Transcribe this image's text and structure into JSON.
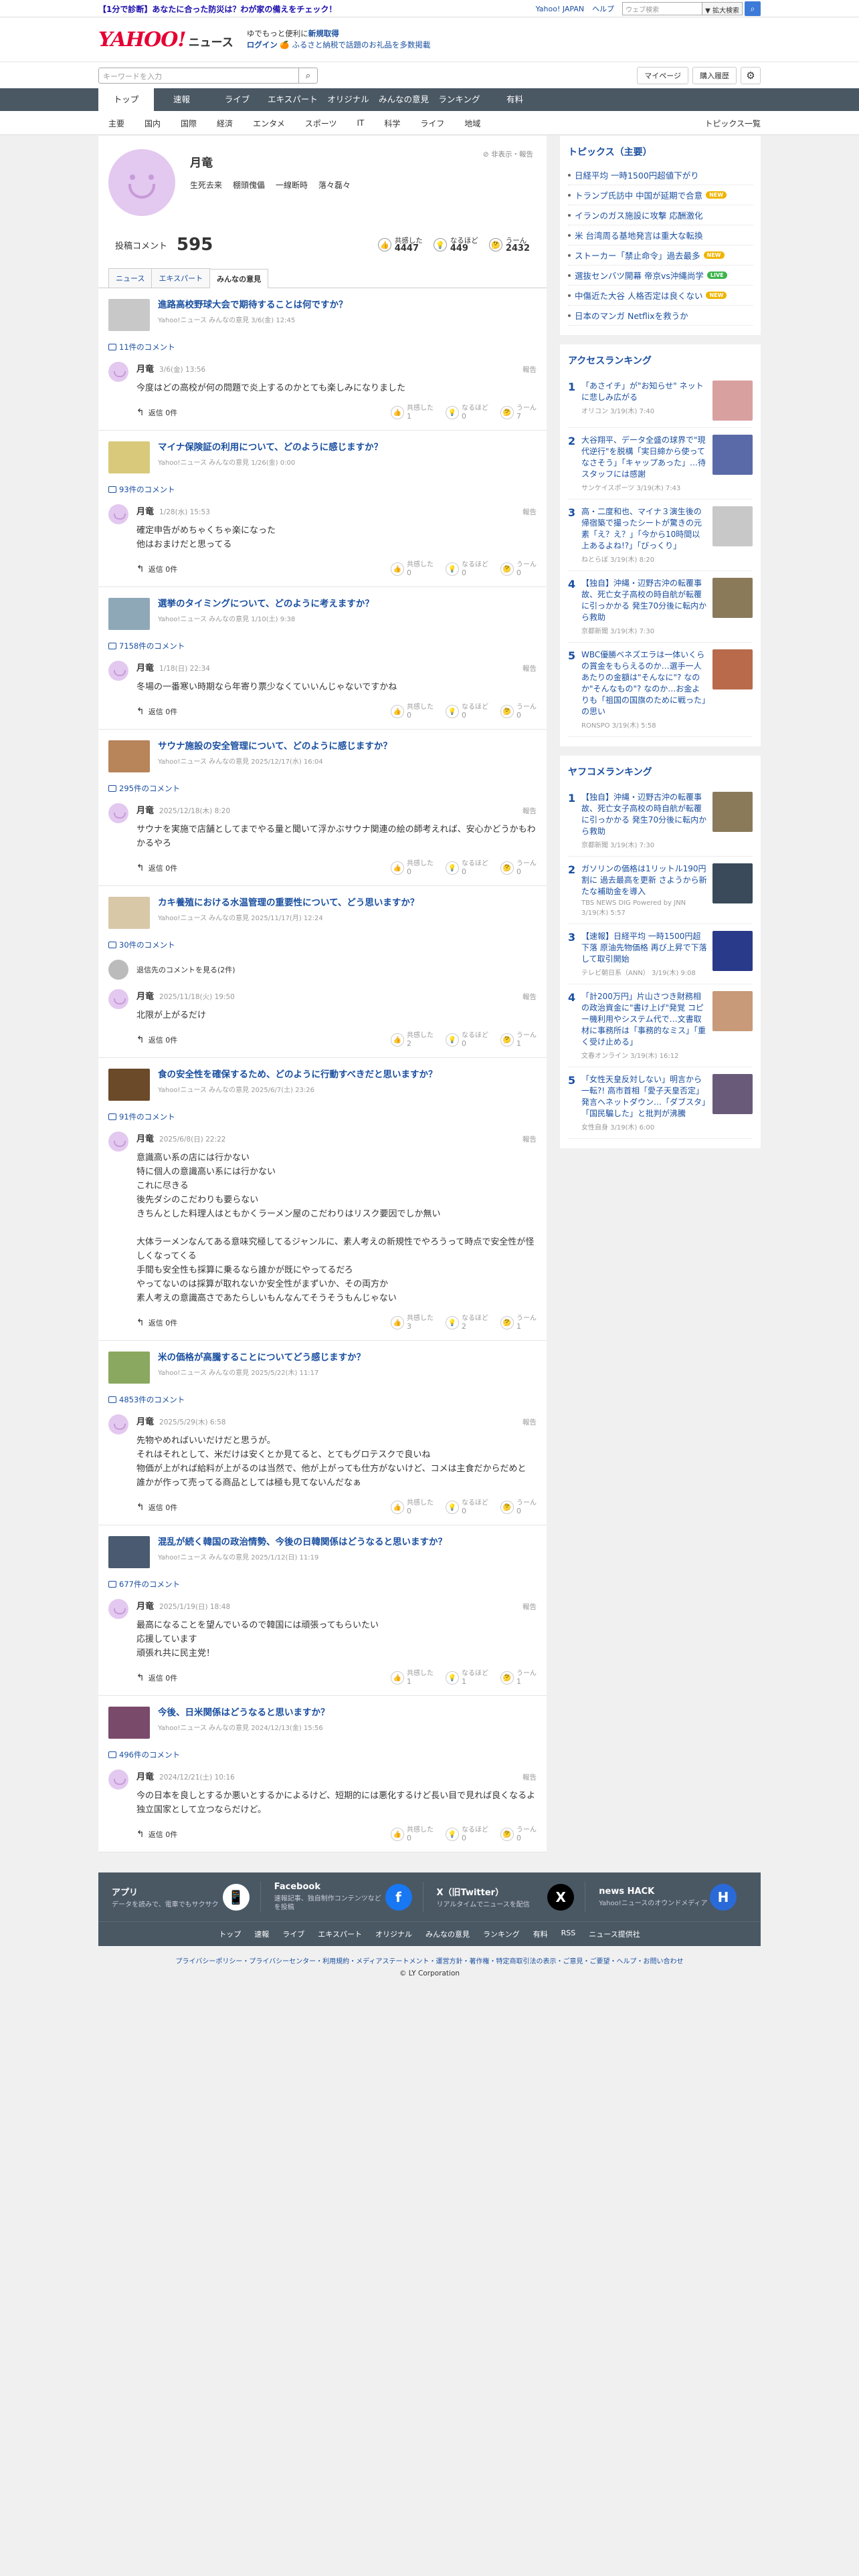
{
  "promo": {
    "text": "【1分で診断】あなたに合った防災は？わが家の備えをチェック！"
  },
  "top_links": {
    "yahoo_japan": "Yahoo! JAPAN",
    "help": "ヘルプ",
    "search_placeholder": "ウェブ検索",
    "search_option": "▼ 拡大検索"
  },
  "logo": {
    "text": "YAHOO!",
    "suffix": "ニュース"
  },
  "header_ad": {
    "line1": "ゆでもっと便利に",
    "line1_bold": "新規取得",
    "login": "ログイン",
    "line2": "🍊 ふるさと納税で話題のお礼品を多数掲載"
  },
  "search": {
    "placeholder": "キーワードを入力",
    "mypage": "マイページ",
    "history": "購入履歴"
  },
  "nav": [
    "トップ",
    "速報",
    "ライブ",
    "エキスパート",
    "オリジナル",
    "みんなの意見",
    "ランキング",
    "有料"
  ],
  "subnav": [
    "主要",
    "国内",
    "国際",
    "経済",
    "エンタメ",
    "スポーツ",
    "IT",
    "科学",
    "ライフ",
    "地域"
  ],
  "subnav_more": "トピックス一覧",
  "profile": {
    "name": "月竜",
    "tags": [
      "生死去来",
      "棚頭傀儡",
      "一線断時",
      "落々磊々"
    ],
    "private_note": "非表示・報告",
    "comments_label": "投稿コメント",
    "comments_count": "595",
    "reacts": [
      {
        "label": "共感した",
        "value": "4447",
        "icon": "👍"
      },
      {
        "label": "なるほど",
        "value": "449",
        "icon": "💡"
      },
      {
        "label": "うーん",
        "value": "2432",
        "icon": "🤔"
      }
    ],
    "tabs": [
      "ニュース",
      "エキスパート",
      "みんなの意見"
    ]
  },
  "cards": [
    {
      "title": "進路高校野球大会で期待することは何ですか？",
      "meta": "Yahoo!ニュース みんなの意見 3/6(金) 12:45",
      "ccount": "11件のコメント",
      "thumb": "#c8c8c8",
      "comments": [
        {
          "name": "月竜",
          "date": "3/6(金) 13:56",
          "text": "今度はどの高校が何の問題で炎上するのかとても楽しみになりました",
          "r": [
            "1",
            "0",
            "7"
          ]
        }
      ]
    },
    {
      "title": "マイナ保険証の利用について、どのように感じますか？",
      "meta": "Yahoo!ニュース みんなの意見 1/26(金) 0:00",
      "ccount": "93件のコメント",
      "thumb": "#d9c97a",
      "comments": [
        {
          "name": "月竜",
          "date": "1/28(水) 15:53",
          "text": "確定申告がめちゃくちゃ楽になった\n他はおまけだと思ってる",
          "r": [
            "0",
            "0",
            "0"
          ]
        }
      ]
    },
    {
      "title": "選挙のタイミングについて、どのように考えますか？",
      "meta": "Yahoo!ニュース みんなの意見 1/10(土) 9:38",
      "ccount": "7158件のコメント",
      "thumb": "#8fa8b8",
      "comments": [
        {
          "name": "月竜",
          "date": "1/18(日) 22:34",
          "text": "冬場の一番寒い時期なら年寄り票少なくていいんじゃないですかね",
          "r": [
            "0",
            "0",
            "0"
          ]
        }
      ]
    },
    {
      "title": "サウナ施設の安全管理について、どのように感じますか？",
      "meta": "Yahoo!ニュース みんなの意見 2025/12/17(水) 16:04",
      "ccount": "295件のコメント",
      "thumb": "#b8845a",
      "comments": [
        {
          "name": "月竜",
          "date": "2025/12/18(木) 8:20",
          "text": "サウナを実施で店舗としてまでやる量と聞いて浮かぶサウナ関連の絵の師考えれば、安心かどうかもわかるやろ",
          "r": [
            "0",
            "0",
            "0"
          ]
        }
      ]
    },
    {
      "title": "カキ養殖における水温管理の重要性について、どう思いますか？",
      "meta": "Yahoo!ニュース みんなの意見 2025/11/17(月) 12:24",
      "ccount": "30件のコメント",
      "thumb": "#d8c8a8",
      "deleted": "退信先のコメントを見る(2件)",
      "comments": [
        {
          "name": "月竜",
          "date": "2025/11/18(火) 19:50",
          "text": "北限が上がるだけ",
          "r": [
            "2",
            "0",
            "1"
          ]
        }
      ]
    },
    {
      "title": "食の安全性を確保するため、どのように行動すべきだと思いますか？",
      "meta": "Yahoo!ニュース みんなの意見 2025/6/7(土) 23:26",
      "ccount": "91件のコメント",
      "thumb": "#6b4a2a",
      "comments": [
        {
          "name": "月竜",
          "date": "2025/6/8(日) 22:22",
          "text": "意識高い系の店には行かない\n特に個人の意識高い系には行かない\nこれに尽きる\n後先ダシのこだわりも要らない\nきちんとした料理人はともかくラーメン屋のこだわりはリスク要因でしか無い\n\n大体ラーメンなんてある意味究極してるジャンルに、素人考えの新規性でやろうって時点で安全性が怪しくなってくる\n手間も安全性も採算に乗るなら誰かが既にやってるだろ\nやってないのは採算が取れないか安全性がまずいか、その両方か\n素人考えの意識高さであたらしいもんなんてそうそうもんじゃない",
          "r": [
            "3",
            "2",
            "1"
          ]
        }
      ]
    },
    {
      "title": "米の価格が高騰することについてどう感じますか？",
      "meta": "Yahoo!ニュース みんなの意見 2025/5/22(木) 11:17",
      "ccount": "4853件のコメント",
      "thumb": "#8aa860",
      "comments": [
        {
          "name": "月竜",
          "date": "2025/5/29(木) 6:58",
          "text": "先物やめればいいだけだと思うが。\nそれはそれとして、米だけは安くとか見てると、とてもグロテスクで良いね\n物価が上がれば給料が上がるのは当然で、他が上がっても仕方がないけど、コメは主食だからだめと\n誰かが作って売ってる商品としては極も見てないんだなぁ",
          "r": [
            "0",
            "0",
            "0"
          ]
        }
      ]
    },
    {
      "title": "混乱が続く韓国の政治情勢、今後の日韓関係はどうなると思いますか？",
      "meta": "Yahoo!ニュース みんなの意見 2025/1/12(日) 11:19",
      "ccount": "677件のコメント",
      "thumb": "#4a5a70",
      "comments": [
        {
          "name": "月竜",
          "date": "2025/1/19(日) 18:48",
          "text": "最高になることを望んでいるので韓国には頑張ってもらいたい\n応援しています\n頑張れ共に民主党！",
          "r": [
            "1",
            "1",
            "1"
          ]
        }
      ]
    },
    {
      "title": "今後、日米関係はどうなると思いますか？",
      "meta": "Yahoo!ニュース みんなの意見 2024/12/13(金) 15:56",
      "ccount": "496件のコメント",
      "thumb": "#7a4a6a",
      "comments": [
        {
          "name": "月竜",
          "date": "2024/12/21(土) 10:16",
          "text": "今の日本を良しとするか悪いとするかによるけど、短期的には悪化するけど長い目で見れば良くなるよ\n独立国家として立つならだけど。",
          "r": [
            "0",
            "0",
            "0"
          ]
        }
      ]
    }
  ],
  "comment_labels": {
    "report": "報告",
    "reply": "返信 0件",
    "r1": "共感した",
    "r2": "なるほど",
    "r3": "うーん"
  },
  "topics": {
    "title": "トピックス（主要）",
    "items": [
      {
        "text": "日経平均 一時1500円超値下がり",
        "badge": ""
      },
      {
        "text": "トランプ氏訪中 中国が延期で合意",
        "badge": "NEW"
      },
      {
        "text": "イランのガス施設に攻撃 応酬激化",
        "badge": ""
      },
      {
        "text": "米 台湾周る基地発言は重大な転換",
        "badge": ""
      },
      {
        "text": "ストーカー「禁止命令」過去最多",
        "badge": "NEW"
      },
      {
        "text": "選抜センバツ開幕 帝京vs沖縄尚学",
        "badge": "LIVE"
      },
      {
        "text": "中傷近た大谷 人格否定は良くない",
        "badge": "NEW"
      },
      {
        "text": "日本のマンガ Netflixを救うか",
        "badge": ""
      }
    ]
  },
  "access": {
    "title": "アクセスランキング",
    "items": [
      {
        "h": "「あさイチ」が\"お知らせ\" ネットに悲しみ広がる",
        "m": "オリコン 3/19(木) 7:40",
        "c": "#d9a0a0"
      },
      {
        "h": "大谷翔平、データ全盛の球界で\"現代逆行\"を脱構「実日締から使ってなさそう」「キャップあった」…待スタッフには感謝",
        "m": "サンケイスポーツ 3/19(木) 7:43",
        "c": "#5a6aa8"
      },
      {
        "h": "高・二度和也、マイナ３演生後の帰宿築で撮ったシートが驚きの元素「え？え？」「今から10時間以上あるよね!?」「びっくり」",
        "m": "ねとらぼ 3/19(木) 8:20",
        "c": "#c8c8c8"
      },
      {
        "h": "【独自】沖縄・辺野古沖の転覆事故、死亡女子高校の時自航が転覆に引っかかる 発生70分後に転内から救助",
        "m": "京都新聞 3/19(木) 7:30",
        "c": "#8a7a5a"
      },
      {
        "h": "WBC優勝ベネズエラは一体いくらの賞金をもらえるのか…選手一人あたりの金額は\"そんなに\"? なのか\"そんなもの\"? なのか…お金よりも「祖国の国旗のために戦った」の思い",
        "m": "RONSPO 3/19(木) 5:58",
        "c": "#b86a4a"
      }
    ]
  },
  "yahoo_rank": {
    "title": "ヤフコメランキング",
    "items": [
      {
        "h": "【独自】沖縄・辺野古沖の転覆事故、死亡女子高校の時自航が転覆に引っかかる 発生70分後に転内から救助",
        "m": "京都新聞 3/19(木) 7:30",
        "c": "#8a7a5a"
      },
      {
        "h": "ガソリンの価格は1リットル190円割に 過去最高を更新 さようから新たな補助金を導入",
        "m": "TBS NEWS DIG Powered by JNN 3/19(木) 5:57",
        "c": "#3a4a5a"
      },
      {
        "h": "【速報】日経平均 一時1500円超下落 原油先物価格 再び上昇で下落して取引開始",
        "m": "テレビ朝日系（ANN） 3/19(木) 9:08",
        "c": "#2a3a8a"
      },
      {
        "h": "「計200万円」片山さつき財務相の政治資金に\"書け上げ\"発覚 コピー機利用やシステム代で…文書取材に事務所は「事務的なミス」「重く受け止める」",
        "m": "文春オンライン 3/19(木) 16:12",
        "c": "#c89a7a"
      },
      {
        "h": "「女性天皇反対しない」明言から一転?! 高市首相「愛子天皇否定」発言へネットダウン…「ダブスタ」「国民騙した」と批判が沸騰",
        "m": "女性自身 3/19(木) 6:00",
        "c": "#6a5a7a"
      }
    ]
  },
  "apps": [
    {
      "title": "アプリ",
      "desc": "データを読みで、電車でもサクサク",
      "icon": "📱",
      "color": "#ffffff"
    },
    {
      "title": "Facebook",
      "desc": "速報記事、独自制作コンテンツなどを投稿",
      "icon": "f",
      "color": "#1877f2"
    },
    {
      "title": "X（旧Twitter）",
      "desc": "リアルタイムでニュースを配信",
      "icon": "X",
      "color": "#000000"
    },
    {
      "title": "news HACK",
      "desc": "Yahoo!ニュースのオウンドメディア",
      "icon": "H",
      "color": "#2a6ad8"
    }
  ],
  "footer_nav": [
    "トップ",
    "速報",
    "ライブ",
    "エキスパート",
    "オリジナル",
    "みんなの意見",
    "ランキング",
    "有料",
    "RSS",
    "ニュース提供社"
  ],
  "footer_links": "プライバシーポリシー・プライバシーセンター・利用規約・メディアステートメント・運営方針・著作権・特定商取引法の表示・ご意見・ご要望・ヘルプ・お問い合わせ",
  "copyright": "© LY Corporation"
}
